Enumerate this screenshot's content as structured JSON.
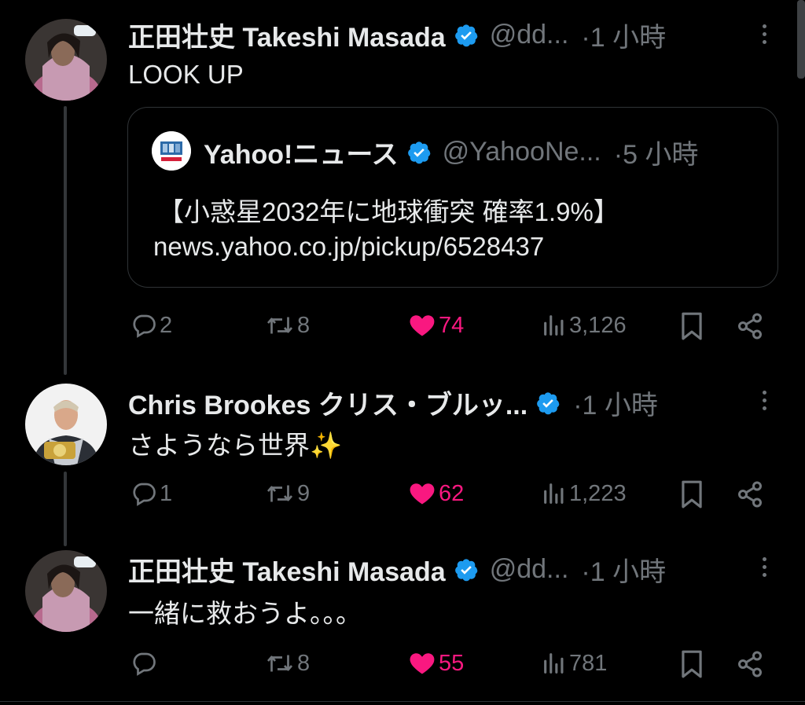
{
  "colors": {
    "background": "#000000",
    "text": "#e7e9ea",
    "muted": "#71767b",
    "like": "#f91880",
    "verified": "#1d9bf0"
  },
  "tweets": [
    {
      "name": "正田壮史 Takeshi Masada",
      "handle": "@dd...",
      "time": "·1 小時",
      "text": "LOOK UP",
      "quote": {
        "name": "Yahoo!ニュース",
        "handle": "@YahooNe...",
        "time": "·5 小時",
        "line1": "【小惑星2032年に地球衝突 確率1.9%】",
        "line2": "news.yahoo.co.jp/pickup/6528437"
      },
      "replies": "2",
      "retweets": "8",
      "likes": "74",
      "views": "3,126"
    },
    {
      "name": "Chris Brookes クリス・ブルッ...",
      "time": "·1 小時",
      "text": "さようなら世界✨",
      "replies": "1",
      "retweets": "9",
      "likes": "62",
      "views": "1,223"
    },
    {
      "name": "正田壮史 Takeshi Masada",
      "handle": "@dd...",
      "time": "·1 小時",
      "text": "一緒に救おうよ。。。",
      "replies": "",
      "retweets": "8",
      "likes": "55",
      "views": "781"
    }
  ],
  "icons": {
    "reply": "reply-icon",
    "retweet": "retweet-icon",
    "like": "heart-icon",
    "views": "views-icon",
    "bookmark": "bookmark-icon",
    "share": "share-icon",
    "more": "more-icon",
    "verified": "verified-badge-icon"
  }
}
